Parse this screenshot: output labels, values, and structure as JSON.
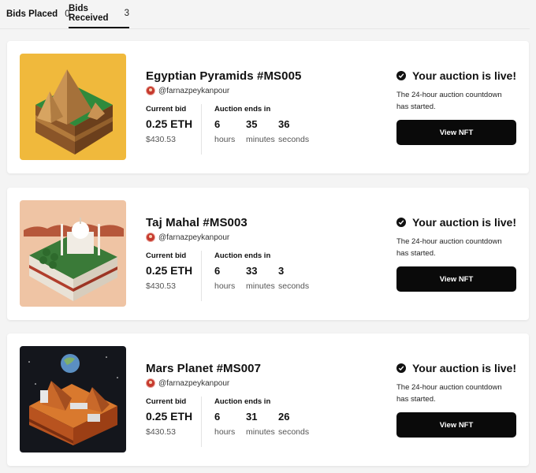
{
  "tabs": [
    {
      "label": "Bids Placed",
      "count": "0"
    },
    {
      "label": "Bids Received",
      "count": "3"
    }
  ],
  "active_tab": 1,
  "cards": [
    {
      "title": "Egyptian Pyramids #MS005",
      "owner": "@farnazpeykanpour",
      "bid_label": "Current bid",
      "bid_eth": "0.25 ETH",
      "bid_usd": "$430.53",
      "ends_label": "Auction ends in",
      "countdown": {
        "hours": "6",
        "minutes": "35",
        "seconds": "36"
      },
      "units": {
        "hours": "hours",
        "minutes": "minutes",
        "seconds": "seconds"
      },
      "live_title": "Your auction is live!",
      "live_desc": "The 24-hour auction countdown has started.",
      "button": "View NFT",
      "thumb_bg": "#f0b93c"
    },
    {
      "title": "Taj Mahal #MS003",
      "owner": "@farnazpeykanpour",
      "bid_label": "Current bid",
      "bid_eth": "0.25 ETH",
      "bid_usd": "$430.53",
      "ends_label": "Auction ends in",
      "countdown": {
        "hours": "6",
        "minutes": "33",
        "seconds": "3"
      },
      "units": {
        "hours": "hours",
        "minutes": "minutes",
        "seconds": "seconds"
      },
      "live_title": "Your auction is live!",
      "live_desc": "The 24-hour auction countdown has started.",
      "button": "View NFT",
      "thumb_bg": "#efc4a4"
    },
    {
      "title": "Mars Planet #MS007",
      "owner": "@farnazpeykanpour",
      "bid_label": "Current bid",
      "bid_eth": "0.25 ETH",
      "bid_usd": "$430.53",
      "ends_label": "Auction ends in",
      "countdown": {
        "hours": "6",
        "minutes": "31",
        "seconds": "26"
      },
      "units": {
        "hours": "hours",
        "minutes": "minutes",
        "seconds": "seconds"
      },
      "live_title": "Your auction is live!",
      "live_desc": "The 24-hour auction countdown has started.",
      "button": "View NFT",
      "thumb_bg": "#14161c"
    }
  ],
  "colors": {
    "button_bg": "#0a0a0a",
    "page_bg": "#f4f4f4",
    "card_bg": "#ffffff"
  }
}
